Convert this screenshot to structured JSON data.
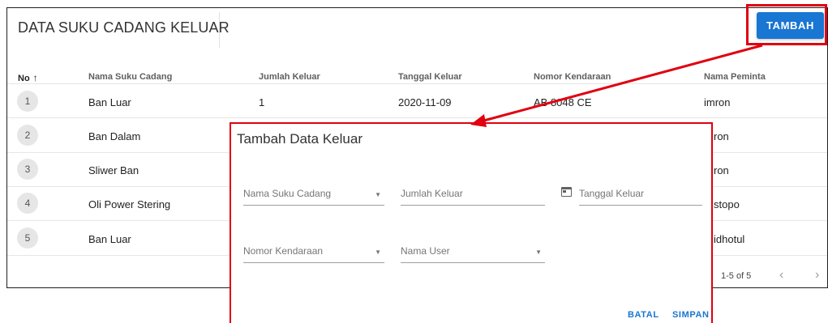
{
  "page": {
    "title": "DATA SUKU CADANG KELUAR",
    "add_button": "TAMBAH"
  },
  "table": {
    "headers": {
      "no": "No",
      "part": "Nama Suku Cadang",
      "qty": "Jumlah Keluar",
      "date": "Tanggal Keluar",
      "vehicle": "Nomor Kendaraan",
      "requester": "Nama Peminta"
    },
    "rows": [
      {
        "no": "1",
        "part": "Ban Luar",
        "qty": "1",
        "date": "2020-11-09",
        "vehicle": "AB 8048 CE",
        "requester": "imron"
      },
      {
        "no": "2",
        "part": "Ban Dalam",
        "requester": "ron"
      },
      {
        "no": "3",
        "part": "Sliwer Ban",
        "requester": "ron"
      },
      {
        "no": "4",
        "part": "Oli Power Stering",
        "requester": "stopo"
      },
      {
        "no": "5",
        "part": "Ban Luar",
        "requester": "idhotul"
      }
    ],
    "pagination": "1-5 of 5"
  },
  "dialog": {
    "title": "Tambah Data Keluar",
    "fields": {
      "part": "Nama Suku Cadang",
      "qty": "Jumlah Keluar",
      "date": "Tanggal Keluar",
      "vehicle": "Nomor Kendaraan",
      "user": "Nama User"
    },
    "cancel": "BATAL",
    "save": "SIMPAN"
  },
  "icons": {
    "sort": "arrow-up-icon",
    "calendar": "calendar-icon",
    "dropdown": "caret-down-icon",
    "prev": "chevron-left-icon",
    "next": "chevron-right-icon"
  },
  "colors": {
    "accent": "#1976d2",
    "annotation": "#e00010"
  }
}
